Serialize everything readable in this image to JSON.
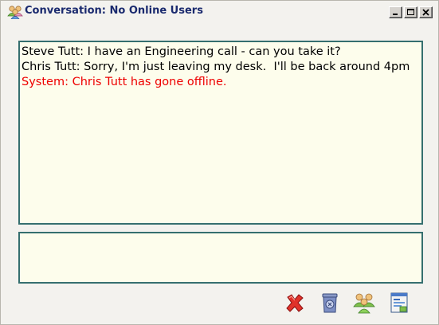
{
  "window": {
    "title": "Conversation: No Online Users",
    "title_icon": "users-group-icon",
    "controls": [
      "minimize",
      "maximize",
      "close"
    ]
  },
  "messages": [
    {
      "text": "Steve Tutt: I have an Engineering call - can you take it?",
      "type": "user"
    },
    {
      "text": "Chris Tutt: Sorry, I'm just leaving my desk.  I'll be back around 4pm",
      "type": "user"
    },
    {
      "text": "System: Chris Tutt has gone offline.",
      "type": "system"
    }
  ],
  "compose": {
    "value": "",
    "placeholder": ""
  },
  "toolbar": [
    {
      "name": "close-conversation-button",
      "icon": "red-x-icon"
    },
    {
      "name": "clear-conversation-button",
      "icon": "trash-bin-icon"
    },
    {
      "name": "invite-users-button",
      "icon": "users-group-icon"
    },
    {
      "name": "conversation-log-button",
      "icon": "document-log-icon"
    }
  ],
  "colors": {
    "title_text": "#1a2a6e",
    "pane_background": "#fdfdec",
    "pane_border": "#356f6f",
    "system_message": "#ee0000"
  }
}
